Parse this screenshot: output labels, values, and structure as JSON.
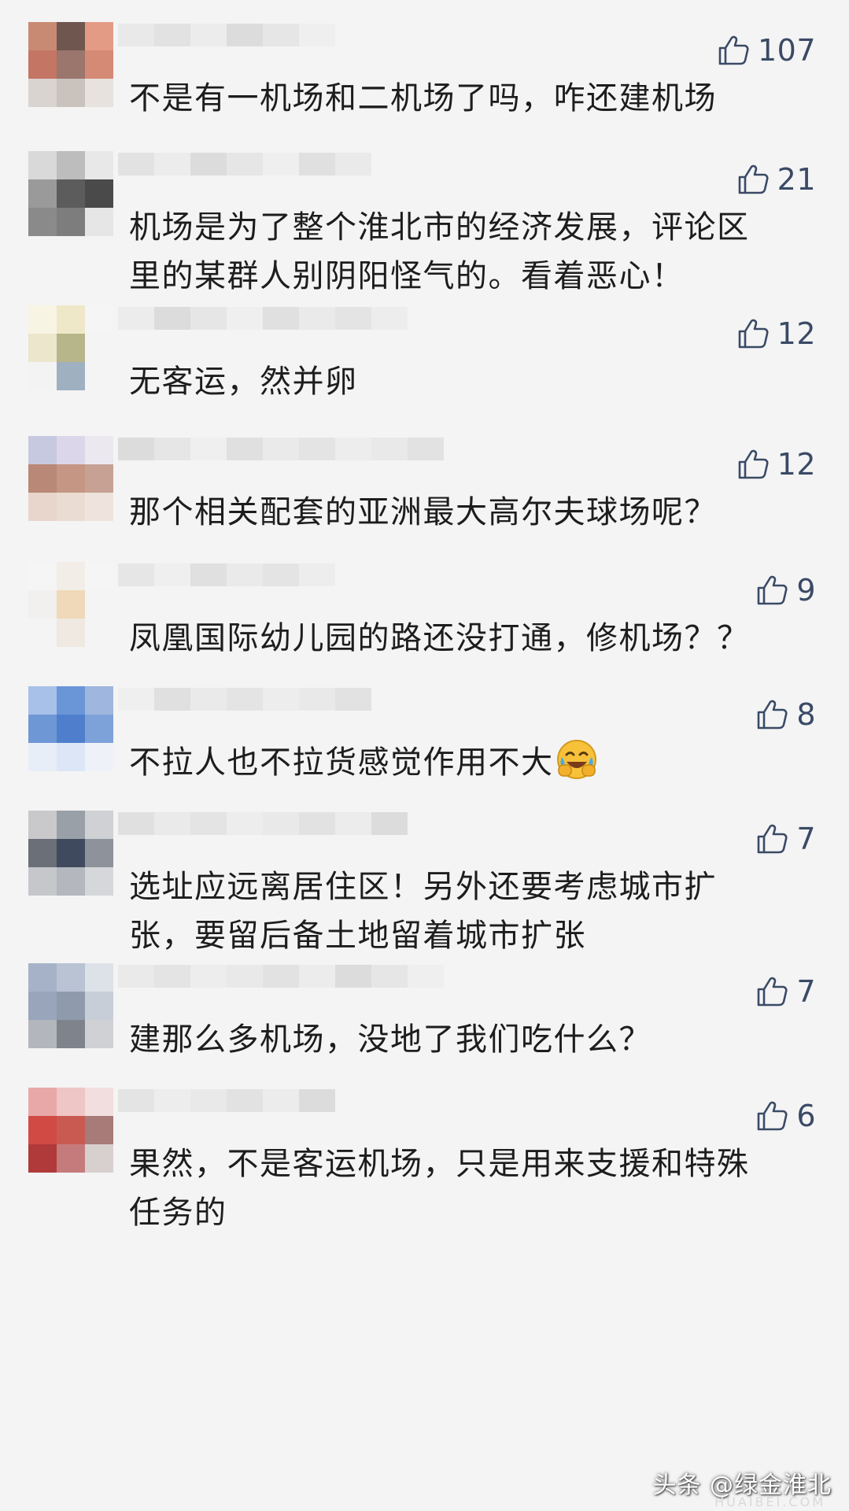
{
  "comments": [
    {
      "likes": "107",
      "text": "不是有一机场和二机场了吗，咋还建机场",
      "avatar": [
        "#c98a73",
        "#6f5750",
        "#e39b85",
        "#c47564",
        "#9b766d",
        "#d48a74",
        "#d9d4d0",
        "#c9c2bd",
        "#e8e2de"
      ]
    },
    {
      "likes": "21",
      "text": "机场是为了整个淮北市的经济发展，评论区\n里的某群人别阴阳怪气的。看着恶心！",
      "avatar": [
        "#d9d9d9",
        "#bdbdbd",
        "#e8e8e8",
        "#9a9a9a",
        "#5c5c5c",
        "#4a4a4a",
        "#8a8a8a",
        "#7d7d7d",
        "#e6e6e6"
      ]
    },
    {
      "likes": "12",
      "text": "无客运，然并卵",
      "avatar": [
        "#f7f4e4",
        "#efe8c8",
        "#f5f5f5",
        "#ece6cd",
        "#b7b58a",
        "#f4f4f4",
        "#f3f3f3",
        "#9fb0c0",
        "#f4f4f4"
      ]
    },
    {
      "likes": "12",
      "text": "那个相关配套的亚洲最大高尔夫球场呢？",
      "avatar": [
        "#c7c9e0",
        "#dcd6ea",
        "#ece8ef",
        "#b98876",
        "#c69684",
        "#c7a193",
        "#e8d6cc",
        "#ebdcd3",
        "#eee3dd"
      ]
    },
    {
      "likes": "9",
      "text": "凤凰国际幼儿园的路还没打通，修机场？？",
      "avatar": [
        "#f5f5f5",
        "#f2ede6",
        "#f5f5f5",
        "#f1f0ee",
        "#f0d9b8",
        "#f4f4f4",
        "#f4f4f4",
        "#efe9e1",
        "#f4f4f4"
      ]
    },
    {
      "likes": "8",
      "text": "不拉人也不拉货感觉作用不大",
      "avatar": [
        "#a8c1e8",
        "#6a96d8",
        "#9fb6de",
        "#6e97d6",
        "#4f7fcc",
        "#7da2da",
        "#e8eef8",
        "#dce6f6",
        "#eef2f8"
      ]
    },
    {
      "likes": "7",
      "text": "选址应远离居住区！另外还要考虑城市扩\n张，要留后备土地留着城市扩张",
      "avatar": [
        "#c9c9cc",
        "#9aa0a8",
        "#cfd1d4",
        "#6b6f78",
        "#3f4a5e",
        "#8d929b",
        "#c5c7cb",
        "#b4b7bd",
        "#d6d7da"
      ]
    },
    {
      "likes": "7",
      "text": "建那么多机场，没地了我们吃什么？",
      "avatar": [
        "#a6b2c8",
        "#b9c3d4",
        "#dde1e8",
        "#99a5bb",
        "#8f9aad",
        "#c8ced8",
        "#b3b6bc",
        "#7f848c",
        "#cfd1d5"
      ]
    },
    {
      "likes": "6",
      "text": "果然，不是客运机场，只是用来支援和特殊\n任务的",
      "avatar": [
        "#e8a8a8",
        "#eec6c6",
        "#f2dede",
        "#d24a44",
        "#c95a52",
        "#a87a78",
        "#b03a3a",
        "#c57b7b",
        "#d8d0cf"
      ]
    }
  ],
  "emoji": {
    "name": "crying-laughing-emoji"
  },
  "watermark": {
    "text": "头条 @绿金淮北",
    "sub": "HUAIBEI.COM"
  },
  "colors": {
    "background": "#f4f4f4",
    "like": "#3a4a66",
    "text": "#1d1d1d"
  }
}
